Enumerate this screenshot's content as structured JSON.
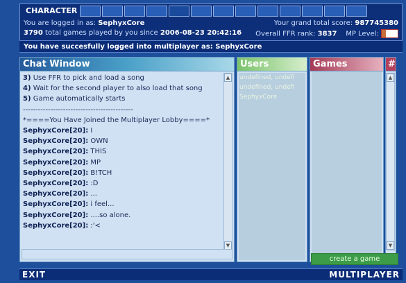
{
  "topbar": {
    "character_label": "CHARACTER",
    "logged_in_text": "You are logged in as:",
    "username": "SephyxCore",
    "games_played_count": "3790",
    "games_played_text": "total games played by you since",
    "since_date": "2006-08-23 20:42:16",
    "grand_total_label": "Your grand total score:",
    "grand_total_value": "987745380",
    "ffr_rank_label": "Overall FFR rank:",
    "ffr_rank_value": "3837",
    "mp_level_label": "MP Level:",
    "mp_level_value": "20"
  },
  "login_message": "You have succesfully logged into multiplayer as: SephyxCore",
  "chat": {
    "title": "Chat Window",
    "lines": [
      {
        "prefix": "3)",
        "text": " Use FFR to pick and load a song"
      },
      {
        "prefix": "4)",
        "text": " Wait for the second player to also load that song"
      },
      {
        "prefix": "5)",
        "text": " Game automatically starts"
      },
      {
        "prefix": "",
        "text": "--------------------------------------------"
      },
      {
        "prefix": "",
        "text": "*====You Have Joined the Multiplayer Lobby====*"
      },
      {
        "prefix": "SephyxCore[20]:",
        "text": " I"
      },
      {
        "prefix": "SephyxCore[20]:",
        "text": " OWN"
      },
      {
        "prefix": "SephyxCore[20]:",
        "text": " THIS"
      },
      {
        "prefix": "SephyxCore[20]:",
        "text": " MP"
      },
      {
        "prefix": "SephyxCore[20]:",
        "text": " B!TCH"
      },
      {
        "prefix": "SephyxCore[20]:",
        "text": " :D"
      },
      {
        "prefix": "SephyxCore[20]:",
        "text": " ..."
      },
      {
        "prefix": "SephyxCore[20]:",
        "text": " i feel..."
      },
      {
        "prefix": "SephyxCore[20]:",
        "text": " ....so alone."
      },
      {
        "prefix": "SephyxCore[20]:",
        "text": " :'<"
      }
    ]
  },
  "users": {
    "title": "Users",
    "items": [
      "undefined, undefi",
      "undefined, undefi",
      "SephyxCore"
    ]
  },
  "games": {
    "title": "Games",
    "hash_label": "#",
    "create_label": "create a game"
  },
  "bottom": {
    "exit_label": "EXIT",
    "mode_label": "MULTIPLAYER"
  }
}
